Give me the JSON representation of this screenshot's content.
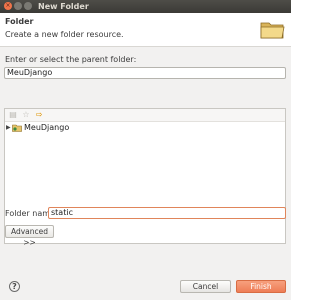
{
  "window": {
    "title": "New Folder"
  },
  "header": {
    "title": "Folder",
    "description": "Create a new folder resource."
  },
  "parent": {
    "label": "Enter or select the parent folder:",
    "value": "MeuDjango"
  },
  "tree": {
    "items": [
      {
        "label": "MeuDjango",
        "expanded": false
      }
    ]
  },
  "folder_name": {
    "label": "Folder name:",
    "value": "static"
  },
  "buttons": {
    "advanced": "Advanced >>",
    "cancel": "Cancel",
    "finish": "Finish"
  },
  "colors": {
    "accent": "#ee7d56",
    "titlebar": "#3b3a36"
  }
}
